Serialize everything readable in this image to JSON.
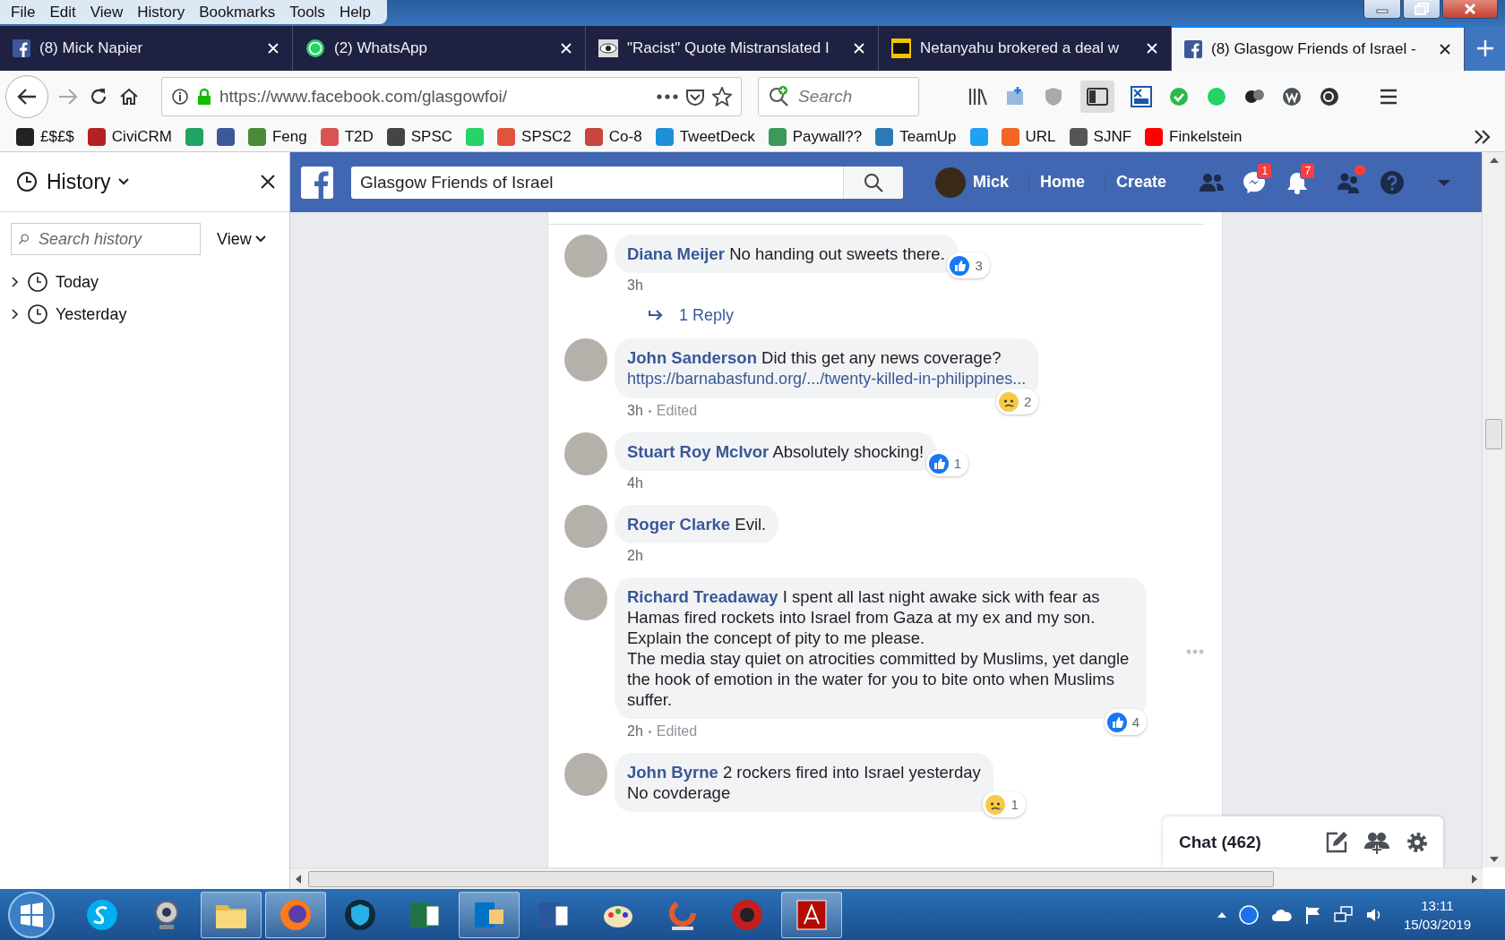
{
  "menu": [
    "File",
    "Edit",
    "View",
    "History",
    "Bookmarks",
    "Tools",
    "Help"
  ],
  "tabs": [
    {
      "label": "(8) Mick Napier",
      "kind": "facebook",
      "selected": false
    },
    {
      "label": "(2) WhatsApp",
      "kind": "whatsapp",
      "selected": false
    },
    {
      "label": "\"Racist\" Quote Mistranslated I",
      "kind": "eye",
      "selected": false
    },
    {
      "label": "Netanyahu brokered a deal w",
      "kind": "news",
      "selected": false
    },
    {
      "label": "(8) Glasgow Friends of Israel -",
      "kind": "facebook",
      "selected": true
    }
  ],
  "navigation": {
    "url": "https://www.facebook.com/glasgowfoi/",
    "search_placeholder": "Search"
  },
  "bookmarks": [
    {
      "label": "£$£$",
      "color": "#222222"
    },
    {
      "label": "CiviCRM",
      "color": "#b22222"
    },
    {
      "color": "#1fa463"
    },
    {
      "color": "#3b5998"
    },
    {
      "label": "Feng",
      "color": "#4a8a3a"
    },
    {
      "label": "T2D",
      "color": "#d9534f"
    },
    {
      "label": "SPSC",
      "color": "#444444"
    },
    {
      "color": "#25d366"
    },
    {
      "label": "SPSC2",
      "color": "#e0533d"
    },
    {
      "label": "Co-8",
      "color": "#c9453f"
    },
    {
      "label": "TweetDeck",
      "color": "#1d8fd8"
    },
    {
      "label": "Paywall??",
      "color": "#3a9a5a"
    },
    {
      "label": "TeamUp",
      "color": "#2a7ab8"
    },
    {
      "color": "#1da1f2"
    },
    {
      "label": "URL",
      "color": "#f26522"
    },
    {
      "label": "SJNF",
      "color": "#555555"
    },
    {
      "label": "Finkelstein",
      "color": "#ff0000"
    }
  ],
  "sidebar": {
    "title": "History",
    "search_placeholder": "Search history",
    "view_label": "View",
    "items": [
      {
        "label": "Today",
        "expanded": false
      },
      {
        "label": "Yesterday",
        "expanded": false
      }
    ]
  },
  "facebook": {
    "search_value": "Glasgow Friends of Israel",
    "profile_name": "Mick",
    "links": [
      "Home",
      "Create"
    ],
    "icons": [
      {
        "kind": "friends",
        "dot": false
      },
      {
        "kind": "messenger",
        "badge": "1",
        "dot": false
      },
      {
        "kind": "notifications",
        "badge": "7",
        "dot": false
      },
      {
        "kind": "requests",
        "dot": true
      },
      {
        "kind": "help",
        "dot": false
      },
      {
        "kind": "caret",
        "dot": false
      }
    ]
  },
  "comments": [
    {
      "author": "Diana Meijer",
      "text": "No handing out sweets there.",
      "time": "3h",
      "reaction": {
        "kind": "like",
        "count": "3"
      },
      "reply_link": "1 Reply",
      "menu_visible": false
    },
    {
      "author": "John Sanderson",
      "text": "Did this get any news coverage?",
      "link": "https://barnabasfund.org/.../twenty-killed-in-philippines...",
      "time": "3h",
      "edited": "Edited",
      "reaction": {
        "kind": "sad",
        "count": "2"
      },
      "menu_visible": false
    },
    {
      "author": "Stuart Roy McIvor",
      "text": "Absolutely shocking!",
      "time": "4h",
      "reaction": {
        "kind": "like",
        "count": "1"
      },
      "menu_visible": false
    },
    {
      "author": "Roger Clarke",
      "text": "Evil.",
      "time": "2h",
      "menu_visible": false
    },
    {
      "author": "Richard Treadaway",
      "text": "I spent all last night awake sick with fear as Hamas fired rockets into Israel from Gaza at my ex and my son.\nExplain the concept of pity to me please.\nThe media stay quiet on atrocities committed by Muslims, yet dangle the hook of emotion in the water for you to bite onto when Muslims suffer.",
      "time": "2h",
      "edited": "Edited",
      "reaction": {
        "kind": "like",
        "count": "4"
      },
      "menu_visible": true
    },
    {
      "author": "John Byrne",
      "text": "2 rockers fired into Israel yesterday\nNo covderage",
      "reaction": {
        "kind": "sad",
        "count": "1"
      },
      "menu_visible": false
    }
  ],
  "chat": {
    "label": "Chat (462)"
  },
  "taskbar": {
    "apps": [
      {
        "kind": "skype",
        "open": false
      },
      {
        "kind": "webcam",
        "open": false
      },
      {
        "kind": "folder",
        "open": true
      },
      {
        "kind": "firefox",
        "open": true
      },
      {
        "kind": "shield",
        "open": false
      },
      {
        "kind": "project",
        "open": false
      },
      {
        "kind": "outlook",
        "open": true
      },
      {
        "kind": "word",
        "open": false
      },
      {
        "kind": "paint",
        "open": false
      },
      {
        "kind": "ring",
        "open": false
      },
      {
        "kind": "gear",
        "open": false
      },
      {
        "kind": "acrobat",
        "open": true
      }
    ],
    "time": "13:11",
    "date": "15/03/2019"
  }
}
